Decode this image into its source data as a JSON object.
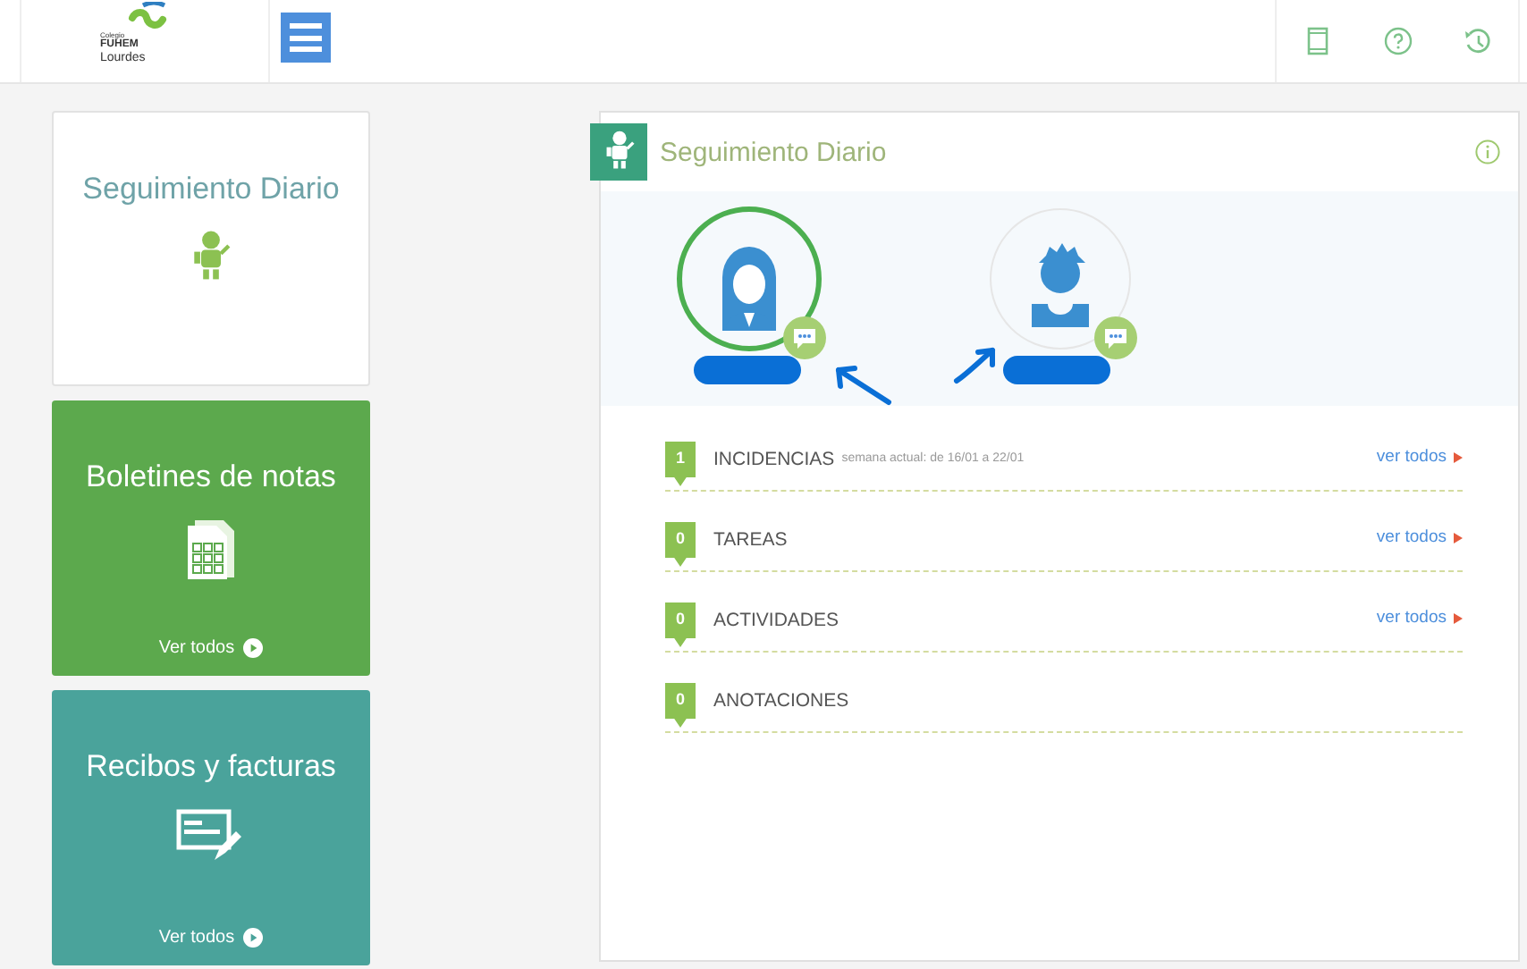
{
  "header": {
    "logo": {
      "lines": [
        "Colegio",
        "FUHEM",
        "Lourdes"
      ]
    },
    "toolbar": [
      {
        "kind": "tablet"
      },
      {
        "kind": "help"
      },
      {
        "kind": "history"
      }
    ]
  },
  "cards": [
    {
      "kind": "tracking",
      "title": "Seguimiento Diario"
    },
    {
      "kind": "grades",
      "title": "Boletines de notas",
      "link": "Ver todos"
    },
    {
      "kind": "receipts",
      "title": "Recibos y facturas",
      "link": "Ver todos"
    }
  ],
  "panel": {
    "title": "Seguimiento Diario",
    "students": [
      {
        "kind": "girl",
        "selected": true
      },
      {
        "kind": "boy",
        "selected": false
      }
    ],
    "sections": [
      {
        "count": "1",
        "label": "INCIDENCIAS",
        "note": "semana actual: de 16/01 a 22/01",
        "link": "ver todos"
      },
      {
        "count": "0",
        "label": "TAREAS",
        "link": "ver todos"
      },
      {
        "count": "0",
        "label": "ACTIVIDADES",
        "link": "ver todos"
      },
      {
        "count": "0",
        "label": "ANOTACIONES"
      }
    ]
  }
}
